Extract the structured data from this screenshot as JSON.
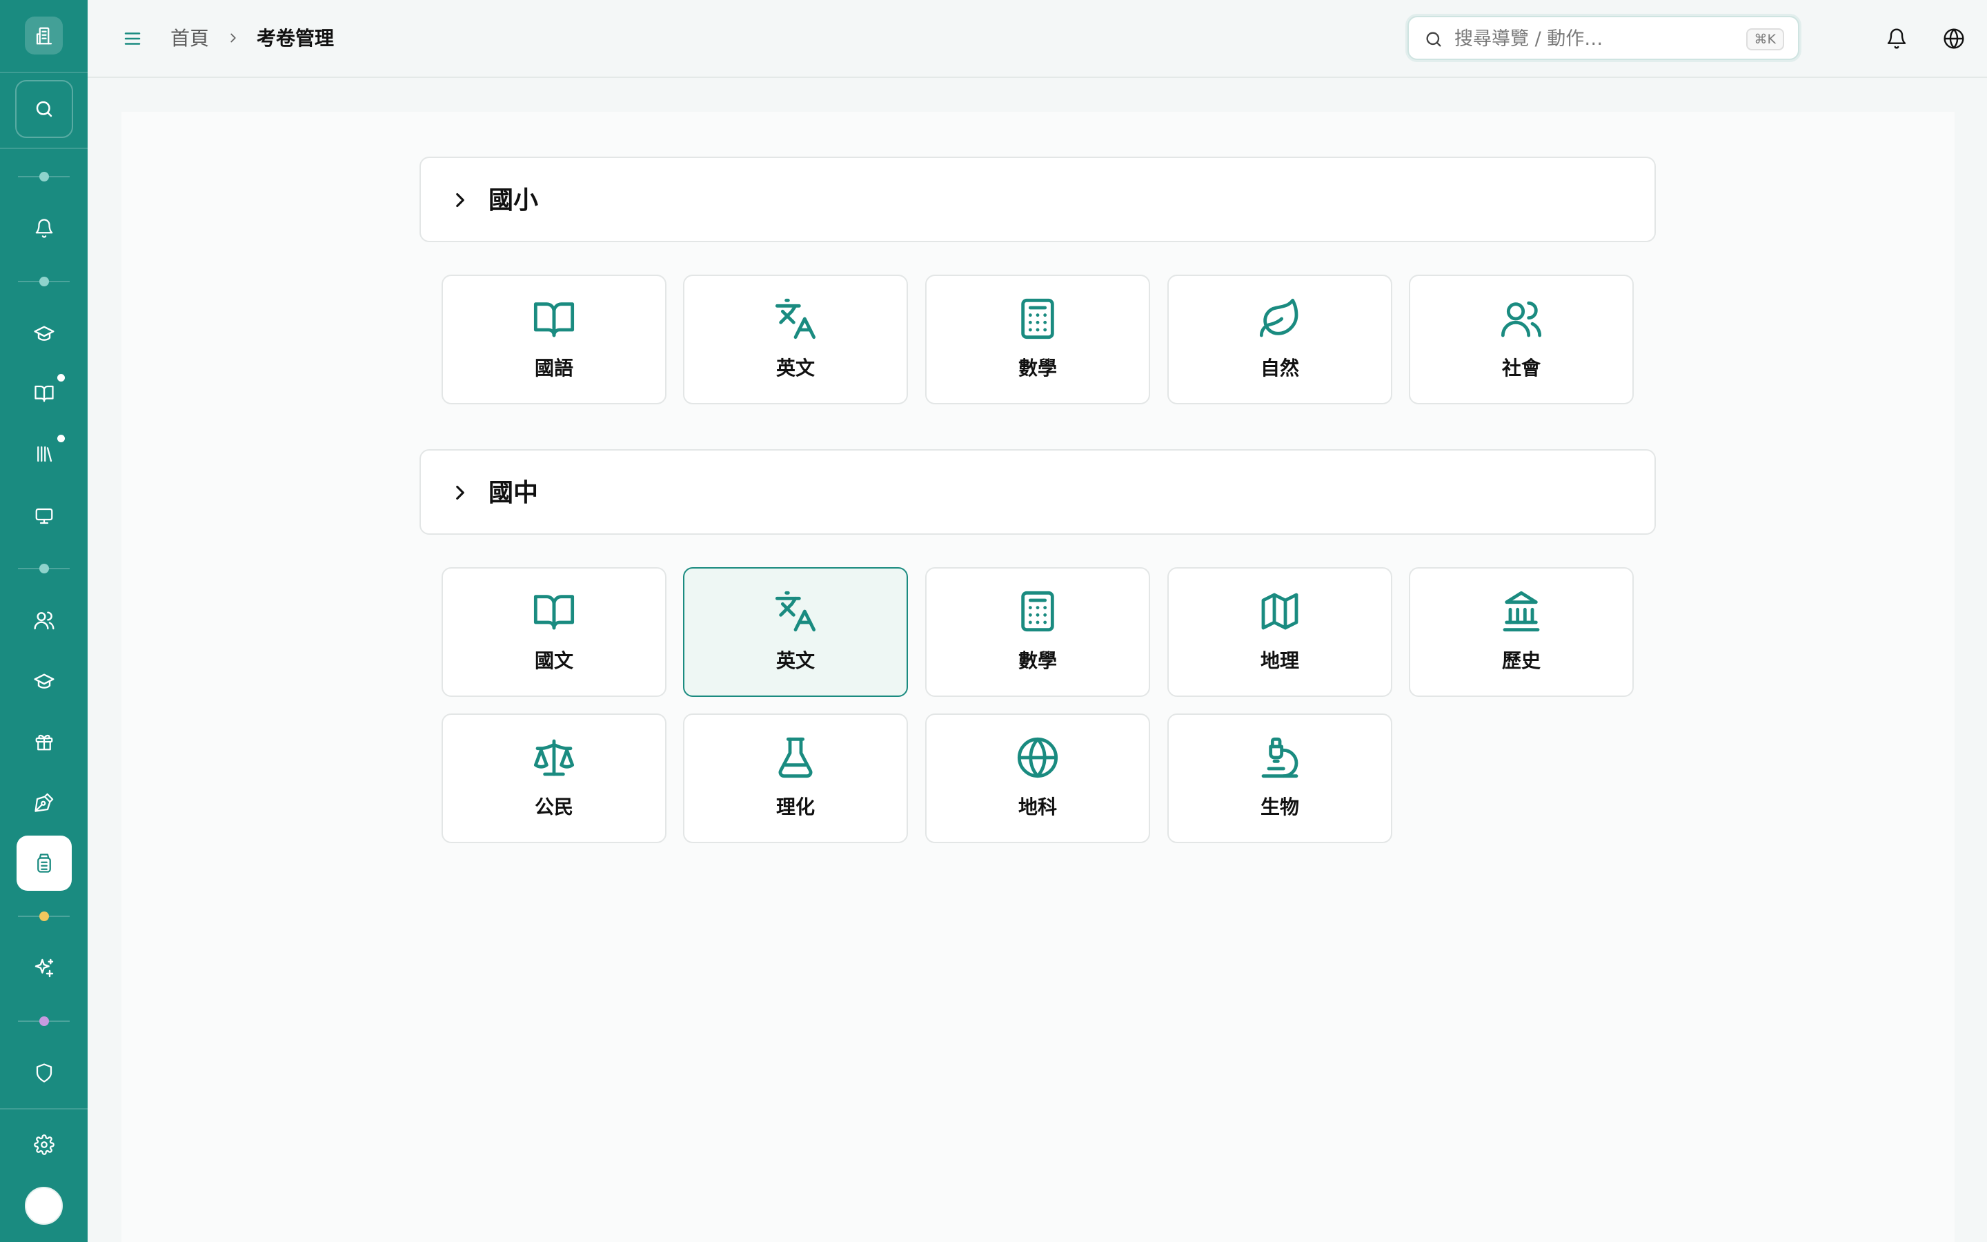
{
  "header": {
    "breadcrumb_home": "首頁",
    "breadcrumb_current": "考卷管理",
    "search_placeholder": "搜尋導覽 / 動作…",
    "search_shortcut": "⌘K"
  },
  "sections": [
    {
      "title": "國小",
      "subjects": [
        {
          "label": "國語",
          "icon": "book-open-icon"
        },
        {
          "label": "英文",
          "icon": "translate-icon"
        },
        {
          "label": "數學",
          "icon": "calculator-icon"
        },
        {
          "label": "自然",
          "icon": "leaf-icon"
        },
        {
          "label": "社會",
          "icon": "users-icon"
        }
      ]
    },
    {
      "title": "國中",
      "subjects": [
        {
          "label": "國文",
          "icon": "book-open-icon"
        },
        {
          "label": "英文",
          "icon": "translate-icon",
          "selected": true
        },
        {
          "label": "數學",
          "icon": "calculator-icon"
        },
        {
          "label": "地理",
          "icon": "map-icon"
        },
        {
          "label": "歷史",
          "icon": "landmark-icon"
        },
        {
          "label": "公民",
          "icon": "scale-icon"
        },
        {
          "label": "理化",
          "icon": "flask-icon"
        },
        {
          "label": "地科",
          "icon": "globe-icon"
        },
        {
          "label": "生物",
          "icon": "microscope-icon"
        }
      ]
    }
  ],
  "colors": {
    "brand": "#1a8b80",
    "selected_bg": "#eef7f4",
    "sep_dot_teal": "#8fd3cc",
    "sep_dot_yellow": "#f0c75e",
    "sep_dot_purple": "#c79be0"
  }
}
